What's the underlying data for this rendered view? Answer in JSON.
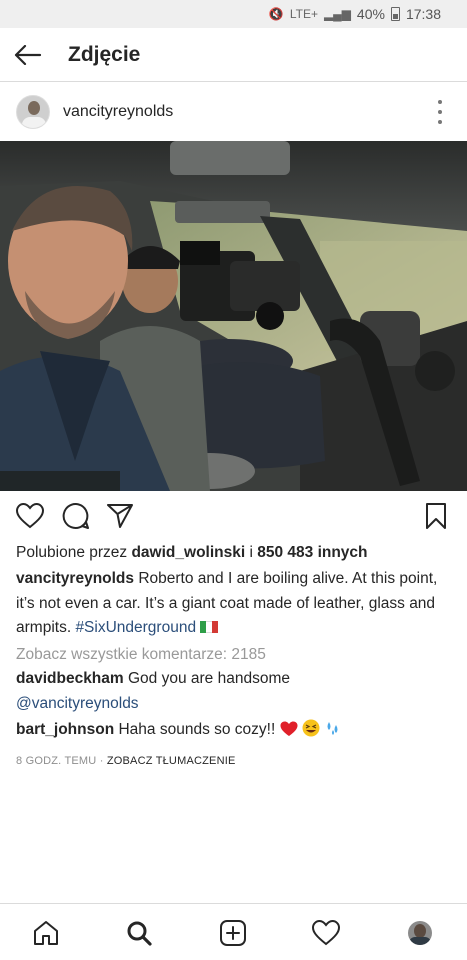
{
  "status_bar": {
    "battery": "40%",
    "time": "17:38",
    "network": "LTE+"
  },
  "header": {
    "title": "Zdjęcie",
    "back_icon": "arrow-left-icon"
  },
  "post": {
    "username": "vancityreynolds",
    "more_icon": "more-vertical-icon",
    "likes": {
      "prefix": "Polubione przez ",
      "first_liker": "dawid_wolinski",
      "connector": " i ",
      "others": "850 483 innych"
    },
    "caption": {
      "author": "vancityreynolds",
      "text": " Roberto and I are boiling alive. At this point, it’s not even a car. It’s a giant coat made of leather, glass and armpits. ",
      "hashtag": "#SixUnderground",
      "flag": "italy-flag"
    },
    "view_comments": "Zobacz wszystkie komentarze: 2185",
    "comments": [
      {
        "author": "davidbeckham",
        "text": " God you are handsome",
        "mention": "@vancityreynolds"
      },
      {
        "author": "bart_johnson",
        "text": " Haha sounds so cozy!! "
      }
    ],
    "time_ago": "8 GODZ. TEMU",
    "separator": " · ",
    "translate": "ZOBACZ TŁUMACZENIE"
  },
  "colors": {
    "link": "#2b4e7a",
    "muted": "#999999",
    "text": "#262626",
    "divider": "#dbdbdb"
  },
  "bottom_nav": [
    {
      "name": "home",
      "icon": "home-icon"
    },
    {
      "name": "search",
      "icon": "search-icon"
    },
    {
      "name": "new-post",
      "icon": "plus-square-icon"
    },
    {
      "name": "activity",
      "icon": "heart-icon"
    },
    {
      "name": "profile",
      "icon": "profile-avatar"
    }
  ]
}
